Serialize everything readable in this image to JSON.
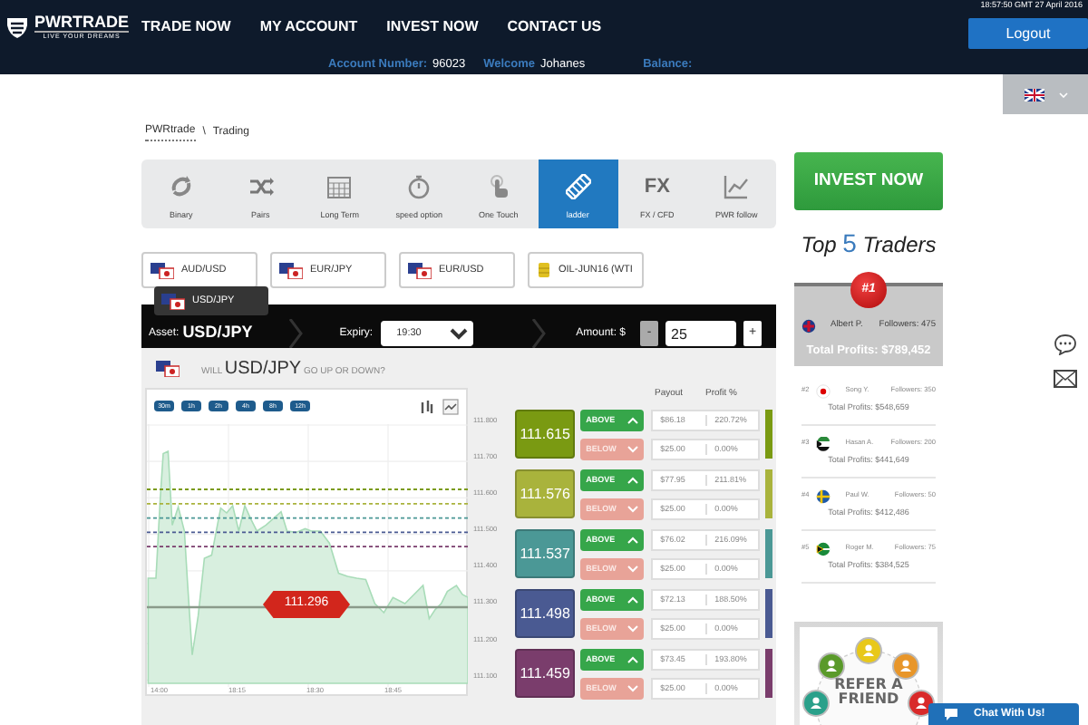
{
  "header": {
    "timestamp": "18:57:50 GMT 27 April 2016",
    "logo": "PWRTRADE",
    "tagline": "LIVE YOUR DREAMS",
    "logout": "Logout",
    "nav": [
      "TRADE NOW",
      "MY ACCOUNT",
      "INVEST NOW",
      "CONTACT US"
    ],
    "account": [
      {
        "label": "Account Number:",
        "value": "96023"
      },
      {
        "label": "Welcome",
        "value": "Johanes"
      },
      {
        "label": "Balance:"
      }
    ]
  },
  "breadcrumb": {
    "link": "PWRtrade",
    "separator": "\\",
    "current": "Trading"
  },
  "tabs": [
    {
      "label": "Binary",
      "selected": false
    },
    {
      "label": "Pairs",
      "selected": false
    },
    {
      "label": "Long Term",
      "selected": false
    },
    {
      "label": "speed option",
      "selected": false
    },
    {
      "label": "One Touch",
      "selected": false
    },
    {
      "label": "ladder",
      "selected": true
    },
    {
      "label": "FX / CFD",
      "selected": false,
      "icon_text": "FX"
    },
    {
      "label": "PWR follow",
      "selected": false
    }
  ],
  "assets": [
    "AUD/USD",
    "EUR/JPY",
    "EUR/USD",
    "OIL-JUN16 (WTI"
  ],
  "asset_tooltip": "USD/JPY",
  "trade_bar": {
    "asset_label": "Asset:",
    "asset": "USD/JPY",
    "expiry_label": "Expiry:",
    "expiry": "19:30",
    "amount_label": "Amount: $",
    "minus": "-",
    "amount": "25",
    "plus": "+"
  },
  "question": {
    "before": "WILL",
    "pair": "USD/JPY",
    "after": "GO UP OR DOWN?"
  },
  "chart": {
    "ranges": [
      "30m",
      "1h",
      "2h",
      "4h",
      "8h",
      "12h"
    ],
    "y_labels": [
      "111.800",
      "111.700",
      "111.600",
      "111.500",
      "111.400",
      "111.300",
      "111.200",
      "111.100"
    ],
    "x_labels": [
      "14:00",
      "18:15",
      "18:30",
      "18:45"
    ],
    "current_price": "111.296"
  },
  "ladder": {
    "headers": [
      "Payout",
      "Profit %"
    ],
    "rows": [
      {
        "price": "111.615",
        "color": "#7a9a12",
        "above": "ABOVE",
        "below": "BELOW",
        "above_payout": "$86.18",
        "above_profit": "220.72%",
        "below_payout": "$25.00",
        "below_profit": "0.00%"
      },
      {
        "price": "111.576",
        "color": "#a9b33c",
        "above": "ABOVE",
        "below": "BELOW",
        "above_payout": "$77.95",
        "above_profit": "211.81%",
        "below_payout": "$25.00",
        "below_profit": "0.00%"
      },
      {
        "price": "111.537",
        "color": "#4b9896",
        "above": "ABOVE",
        "below": "BELOW",
        "above_payout": "$76.02",
        "above_profit": "216.09%",
        "below_payout": "$25.00",
        "below_profit": "0.00%"
      },
      {
        "price": "111.498",
        "color": "#4a5a92",
        "above": "ABOVE",
        "below": "BELOW",
        "above_payout": "$72.13",
        "above_profit": "188.50%",
        "below_payout": "$25.00",
        "below_profit": "0.00%"
      },
      {
        "price": "111.459",
        "color": "#7a3d6c",
        "above": "ABOVE",
        "below": "BELOW",
        "above_payout": "$73.45",
        "above_profit": "193.80%",
        "below_payout": "$25.00",
        "below_profit": "0.00%"
      }
    ]
  },
  "invest_button": "INVEST NOW",
  "top_traders": {
    "title_before": "Top",
    "count": "5",
    "title_after": "Traders",
    "leader": {
      "rank": "#1",
      "name": "Albert P.",
      "followers": "Followers: 475",
      "profits": "Total Profits: $789,452"
    },
    "others": [
      {
        "rank": "#2",
        "name": "Song Y.",
        "followers": "Followers: 350",
        "profits": "Total Profits: $548,659"
      },
      {
        "rank": "#3",
        "name": "Hasan A.",
        "followers": "Followers: 200",
        "profits": "Total Profits: $441,649"
      },
      {
        "rank": "#4",
        "name": "Paul W.",
        "followers": "Followers: 50",
        "profits": "Total Profits: $412,486"
      },
      {
        "rank": "#5",
        "name": "Roger M.",
        "followers": "Followers: 75",
        "profits": "Total Profits: $384,525"
      }
    ]
  },
  "refer_banner": [
    "REFER A",
    "FRIEND"
  ],
  "chat": "Chat With Us!"
}
